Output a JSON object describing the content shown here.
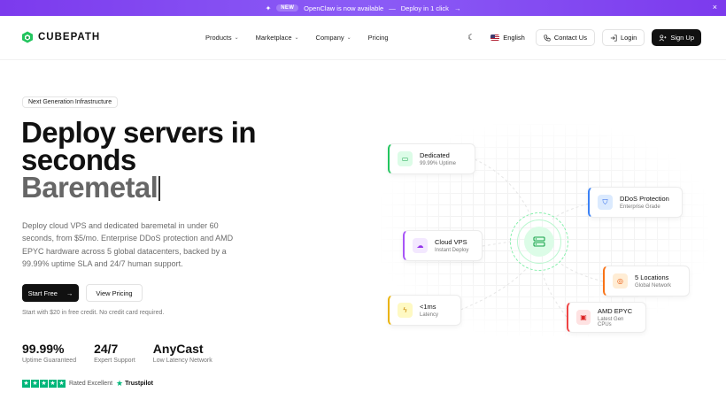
{
  "announcement": {
    "badge": "NEW",
    "message": "OpenClaw is now available",
    "separator": "—",
    "cta": "Deploy in 1 click",
    "cta_arrow": "→",
    "close": "×"
  },
  "brand": {
    "name": "CUBEPATH",
    "color": "#22c55e"
  },
  "nav": {
    "items": [
      {
        "label": "Products",
        "has_dropdown": true
      },
      {
        "label": "Marketplace",
        "has_dropdown": true
      },
      {
        "label": "Company",
        "has_dropdown": true
      },
      {
        "label": "Pricing",
        "has_dropdown": false
      }
    ],
    "language": "English",
    "contact": "Contact Us",
    "login": "Login",
    "signup": "Sign Up"
  },
  "hero": {
    "chip": "Next Generation Infrastructure",
    "title_line1": "Deploy servers in",
    "title_line2": "seconds",
    "typed_word": "Baremetal",
    "description": "Deploy cloud VPS and dedicated baremetal in under 60 seconds, from $5/mo. Enterprise DDoS protection and AMD EPYC hardware across 5 global datacenters, backed by a 99.99% uptime SLA and 24/7 human support.",
    "start_label": "Start Free",
    "start_arrow": "→",
    "pricing_label": "View Pricing",
    "credit_note": "Start with $20 in free credit. No credit card required."
  },
  "stats": [
    {
      "value": "99.99%",
      "label": "Uptime Guaranteed"
    },
    {
      "value": "24/7",
      "label": "Expert Support"
    },
    {
      "value": "AnyCast",
      "label": "Low Latency Network"
    }
  ],
  "trust": {
    "rating_text": "Rated Excellent",
    "provider": "Trustpilot",
    "stars": 5
  },
  "diagram": {
    "cards": [
      {
        "id": "dedicated",
        "title": "Dedicated",
        "subtitle": "99.99% Uptime",
        "accent": "#22c55e",
        "icon": "monitor-icon"
      },
      {
        "id": "ddos",
        "title": "DDoS Protection",
        "subtitle": "Enterprise Grade",
        "accent": "#3b82f6",
        "icon": "shield-icon"
      },
      {
        "id": "cloud",
        "title": "Cloud VPS",
        "subtitle": "Instant Deploy",
        "accent": "#a855f7",
        "icon": "cloud-icon"
      },
      {
        "id": "locations",
        "title": "5 Locations",
        "subtitle": "Global Network",
        "accent": "#f97316",
        "icon": "globe-icon"
      },
      {
        "id": "latency",
        "title": "<1ms",
        "subtitle": "Latency",
        "accent": "#eab308",
        "icon": "bolt-icon"
      },
      {
        "id": "epyc",
        "title": "AMD EPYC",
        "subtitle": "Latest Gen CPUs",
        "accent": "#ef4444",
        "icon": "cpu-icon"
      }
    ],
    "hub_icon": "server-icon"
  }
}
